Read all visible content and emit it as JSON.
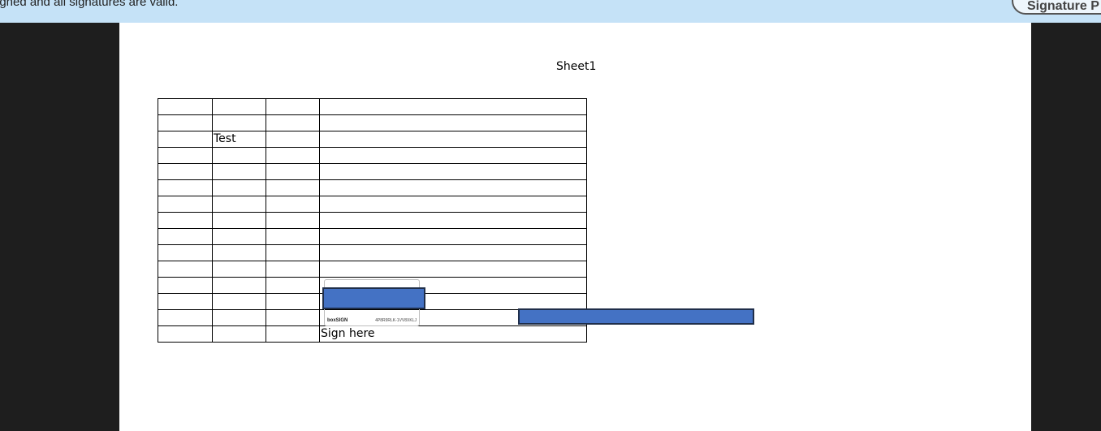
{
  "signature_bar": {
    "message": "igned and all signatures are valid.",
    "panel_button": "Signature P"
  },
  "document": {
    "sheet_title": "Sheet1",
    "table": {
      "rows": [
        [
          "",
          "",
          "",
          ""
        ],
        [
          "",
          "",
          "",
          ""
        ],
        [
          "",
          "Test",
          "",
          ""
        ],
        [
          "",
          "",
          "",
          ""
        ],
        [
          "",
          "",
          "",
          ""
        ],
        [
          "",
          "",
          "",
          ""
        ],
        [
          "",
          "",
          "",
          ""
        ],
        [
          "",
          "",
          "",
          ""
        ],
        [
          "",
          "",
          "",
          ""
        ],
        [
          "",
          "",
          "",
          ""
        ],
        [
          "",
          "",
          "",
          ""
        ],
        [
          "",
          "",
          "",
          ""
        ],
        [
          "",
          "",
          "",
          ""
        ],
        [
          "",
          "",
          "",
          ""
        ],
        [
          "",
          "",
          "",
          "Sign here"
        ]
      ]
    },
    "signature_widget": {
      "logo": "boxSIGN",
      "id": "4P8R9RLK-1VV8XKLJ"
    }
  },
  "colors": {
    "bar_bg": "#c5e2f7",
    "redaction": "#4472c4",
    "viewer_bg": "#1e1e1e"
  }
}
